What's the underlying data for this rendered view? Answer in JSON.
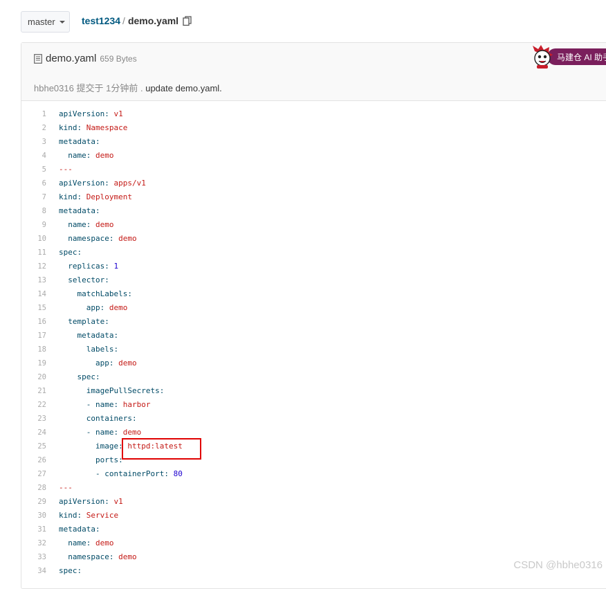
{
  "branch": {
    "label": "master"
  },
  "breadcrumb": {
    "repo": "test1234",
    "separator": "/",
    "file": "demo.yaml"
  },
  "file": {
    "name": "demo.yaml",
    "size": "659 Bytes",
    "commit": {
      "author": "hbhe0316",
      "action": "提交于",
      "time": "1分钟前",
      "separator": ".",
      "message": "update demo.yaml."
    }
  },
  "ai_helper": {
    "label": "马建仓 AI 助手"
  },
  "watermark": "CSDN @hbhe0316",
  "colors": {
    "highlight": "#e00000",
    "link": "#005980",
    "ai_pill": "#7a1f5c"
  },
  "code_lines": [
    {
      "n": "1",
      "key": "apiVersion",
      "val": "v1"
    },
    {
      "n": "2",
      "key": "kind",
      "val": "Namespace"
    },
    {
      "n": "3",
      "key": "metadata",
      "val": ""
    },
    {
      "n": "4",
      "indent": "  ",
      "key": "name",
      "val": "demo"
    },
    {
      "n": "5",
      "raw": "---"
    },
    {
      "n": "6",
      "key": "apiVersion",
      "val": "apps/v1"
    },
    {
      "n": "7",
      "key": "kind",
      "val": "Deployment"
    },
    {
      "n": "8",
      "key": "metadata",
      "val": ""
    },
    {
      "n": "9",
      "indent": "  ",
      "key": "name",
      "val": "demo"
    },
    {
      "n": "10",
      "indent": "  ",
      "key": "namespace",
      "val": "demo"
    },
    {
      "n": "11",
      "key": "spec",
      "val": ""
    },
    {
      "n": "12",
      "indent": "  ",
      "key": "replicas",
      "num": "1"
    },
    {
      "n": "13",
      "indent": "  ",
      "key": "selector",
      "val": ""
    },
    {
      "n": "14",
      "indent": "    ",
      "key": "matchLabels",
      "val": ""
    },
    {
      "n": "15",
      "indent": "      ",
      "key": "app",
      "val": "demo"
    },
    {
      "n": "16",
      "indent": "  ",
      "key": "template",
      "val": ""
    },
    {
      "n": "17",
      "indent": "    ",
      "key": "metadata",
      "val": ""
    },
    {
      "n": "18",
      "indent": "      ",
      "key": "labels",
      "val": ""
    },
    {
      "n": "19",
      "indent": "        ",
      "key": "app",
      "val": "demo"
    },
    {
      "n": "20",
      "indent": "    ",
      "key": "spec",
      "val": ""
    },
    {
      "n": "21",
      "indent": "      ",
      "key": "imagePullSecrets",
      "val": ""
    },
    {
      "n": "22",
      "indent": "      ",
      "dash": true,
      "key": "name",
      "val": "harbor"
    },
    {
      "n": "23",
      "indent": "      ",
      "key": "containers",
      "val": ""
    },
    {
      "n": "24",
      "indent": "      ",
      "dash": true,
      "key": "name",
      "val": "demo"
    },
    {
      "n": "25",
      "indent": "        ",
      "key": "image",
      "val": "httpd:latest"
    },
    {
      "n": "26",
      "indent": "        ",
      "key": "ports",
      "val": ""
    },
    {
      "n": "27",
      "indent": "        ",
      "dash": true,
      "key": "containerPort",
      "num": "80"
    },
    {
      "n": "28",
      "raw": "---"
    },
    {
      "n": "29",
      "key": "apiVersion",
      "val": "v1"
    },
    {
      "n": "30",
      "key": "kind",
      "val": "Service"
    },
    {
      "n": "31",
      "key": "metadata",
      "val": ""
    },
    {
      "n": "32",
      "indent": "  ",
      "key": "name",
      "val": "demo"
    },
    {
      "n": "33",
      "indent": "  ",
      "key": "namespace",
      "val": "demo"
    },
    {
      "n": "34",
      "key": "spec",
      "val": ""
    }
  ]
}
